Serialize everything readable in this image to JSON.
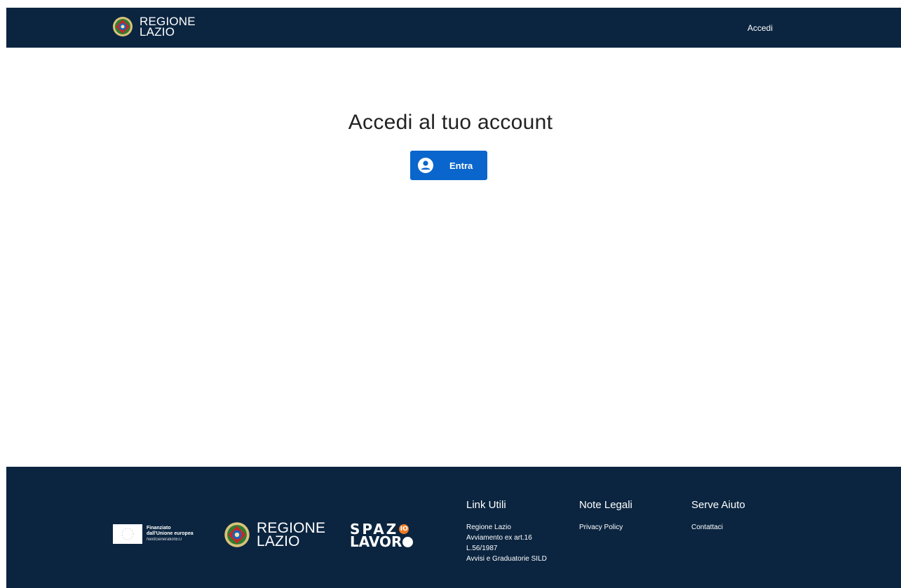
{
  "header": {
    "brand_line1": "REGIONE",
    "brand_line2": "LAZIO",
    "login_link": "Accedi"
  },
  "main": {
    "title": "Accedi al tuo account",
    "enter_button": "Entra"
  },
  "footer": {
    "eu": {
      "line1": "Finanziato",
      "line2": "dall'Unione europea",
      "line3": "NextGenerationEU"
    },
    "lazio": {
      "line1": "REGIONE",
      "line2": "LAZIO"
    },
    "spazio": {
      "line1": "SPAZ",
      "badge": "IO",
      "line2": "LAVOR"
    },
    "columns": [
      {
        "title": "Link Utili",
        "links": [
          "Regione Lazio",
          "Avviamento ex art.16 L.56/1987",
          "Avvisi e Graduatorie SILD"
        ]
      },
      {
        "title": "Note Legali",
        "links": [
          "Privacy Policy"
        ]
      },
      {
        "title": "Serve Aiuto",
        "links": [
          "Contattaci"
        ]
      }
    ]
  },
  "colors": {
    "navy": "#0b2540",
    "button_blue": "#0a66cc",
    "accent_orange": "#f07a23"
  },
  "icons": {
    "brand": "regione-lazio-crest-icon",
    "button": "user-circle-icon",
    "eu": "eu-flag-icon"
  }
}
